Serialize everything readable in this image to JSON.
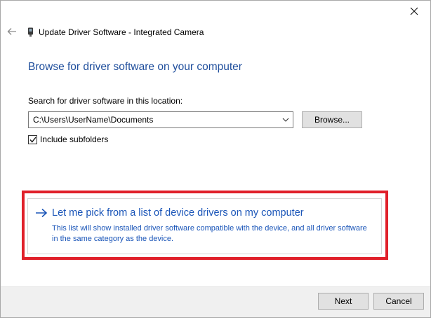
{
  "window": {
    "title": "Update Driver Software - Integrated Camera",
    "heading": "Browse for driver software on your computer"
  },
  "location": {
    "label": "Search for driver software in this location:",
    "path": "C:\\Users\\UserName\\Documents",
    "browse_label": "Browse..."
  },
  "subfolders": {
    "label": "Include subfolders",
    "checked": true
  },
  "pick_option": {
    "title": "Let me pick from a list of device drivers on my computer",
    "description": "This list will show installed driver software compatible with the device, and all driver software in the same category as the device."
  },
  "footer": {
    "next_label": "Next",
    "cancel_label": "Cancel"
  },
  "colors": {
    "heading": "#1f4e9c",
    "link": "#1a55b8",
    "highlight": "#e0202a"
  },
  "icons": [
    "close-icon",
    "back-arrow-icon",
    "camera-device-icon",
    "chevron-down-icon",
    "checkmark-icon",
    "arrow-right-icon"
  ]
}
